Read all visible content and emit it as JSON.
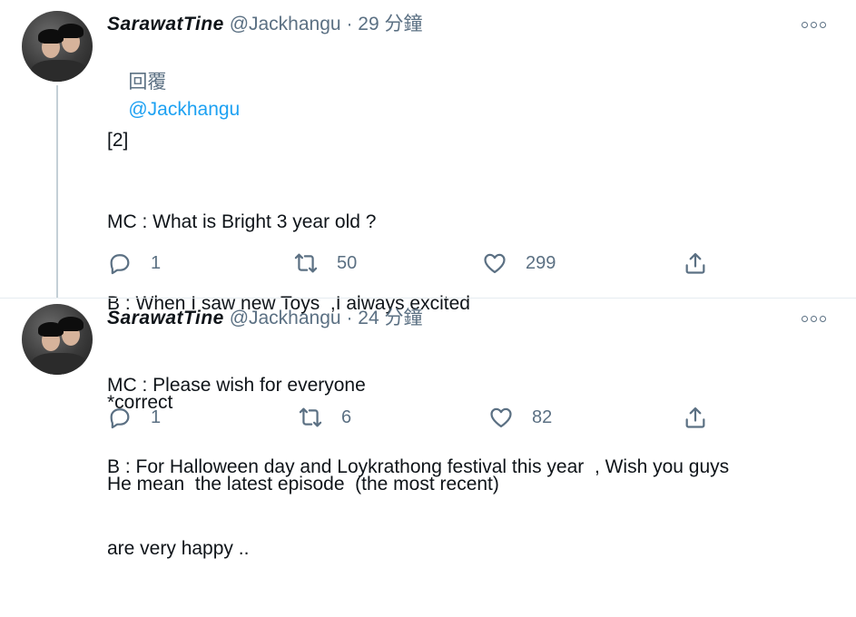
{
  "tweets": [
    {
      "display_name": "SarawatTine",
      "handle": "@Jackhangu",
      "separator": "·",
      "time": "29 分鐘",
      "reply_prefix": "回覆",
      "reply_to": "@Jackhangu",
      "lines": [
        "[2]",
        "MC : What is Bright 3 year old ?",
        "B : When I saw new Toys  ,I always excited",
        "MC : Please wish for everyone",
        "B : For Halloween day and Loykrathong festival this year  , Wish you guys",
        "are very happy .."
      ],
      "replies": "1",
      "retweets": "50",
      "likes": "299"
    },
    {
      "display_name": "SarawatTine",
      "handle": "@Jackhangu",
      "separator": "·",
      "time": "24 分鐘",
      "lines": [
        "*correct",
        "He mean  the latest episode  (the most recent)"
      ],
      "replies": "1",
      "retweets": "6",
      "likes": "82"
    }
  ],
  "icons": {
    "more": "more-icon",
    "reply": "reply-icon",
    "retweet": "retweet-icon",
    "like": "like-icon",
    "share": "share-icon"
  },
  "colors": {
    "text": "#0f1419",
    "secondary": "#5b7083",
    "link": "#1da1f2",
    "divider": "#e6ecf0",
    "thread_line": "#c4cfd6"
  }
}
